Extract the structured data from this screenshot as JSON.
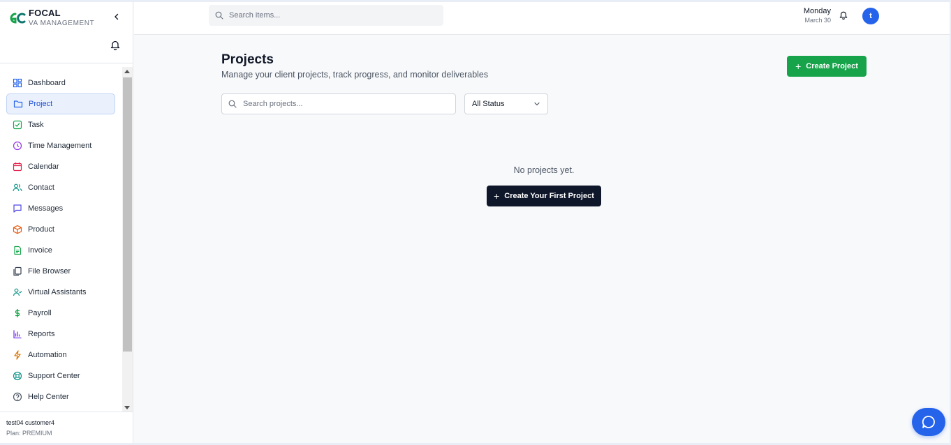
{
  "brand": {
    "name": "FOCAL",
    "subtitle": "VA MANAGEMENT",
    "logo_icon": "gc-logo-icon"
  },
  "sidebar": {
    "items": [
      {
        "label": "Dashboard",
        "icon": "dashboard-icon",
        "color": "#2563eb"
      },
      {
        "label": "Project",
        "icon": "folder-icon",
        "color": "#2563eb",
        "active": true
      },
      {
        "label": "Task",
        "icon": "checkbox-icon",
        "color": "#16a34a"
      },
      {
        "label": "Time Management",
        "icon": "clock-icon",
        "color": "#9333ea"
      },
      {
        "label": "Calendar",
        "icon": "calendar-icon",
        "color": "#e11d48"
      },
      {
        "label": "Contact",
        "icon": "users-icon",
        "color": "#0d9488"
      },
      {
        "label": "Messages",
        "icon": "message-icon",
        "color": "#4f46e5"
      },
      {
        "label": "Product",
        "icon": "package-icon",
        "color": "#ea580c"
      },
      {
        "label": "Invoice",
        "icon": "invoice-icon",
        "color": "#16a34a"
      },
      {
        "label": "File Browser",
        "icon": "files-icon",
        "color": "#374151"
      },
      {
        "label": "Virtual Assistants",
        "icon": "user-check-icon",
        "color": "#0d9488"
      },
      {
        "label": "Payroll",
        "icon": "dollar-icon",
        "color": "#16a34a"
      },
      {
        "label": "Reports",
        "icon": "bar-chart-icon",
        "color": "#7c3aed"
      },
      {
        "label": "Automation",
        "icon": "lightning-icon",
        "color": "#d97706"
      },
      {
        "label": "Support Center",
        "icon": "lifebuoy-icon",
        "color": "#0d9488"
      },
      {
        "label": "Help Center",
        "icon": "help-circle-icon",
        "color": "#4b5563"
      }
    ]
  },
  "user": {
    "name": "test04 customer4",
    "plan": "Plan: PREMIUM"
  },
  "topbar": {
    "search_placeholder": "Search items...",
    "day": "Monday",
    "date": "March 30",
    "avatar_initial": "t"
  },
  "main": {
    "title": "Projects",
    "subtitle": "Manage your client projects, track progress, and monitor deliverables",
    "create_label": "Create Project",
    "search_placeholder": "Search projects...",
    "status_selected": "All Status",
    "empty_text": "No projects yet.",
    "first_project_label": "Create Your First Project"
  },
  "colors": {
    "accent": "#2563eb",
    "success": "#16a34a",
    "dark": "#0f172a"
  }
}
